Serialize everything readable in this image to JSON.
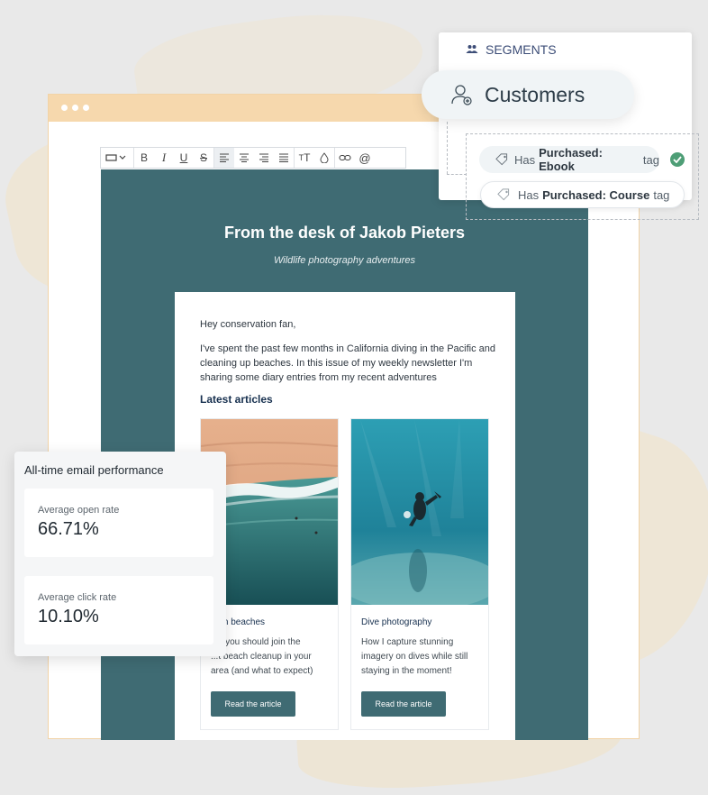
{
  "toolbar": {
    "tools": [
      "block-style-icon",
      "bold-icon",
      "italic-icon",
      "underline-icon",
      "strikethrough-icon",
      "align-left-icon",
      "align-center-icon",
      "align-right-icon",
      "align-justify-icon",
      "text-size-icon",
      "color-drop-icon",
      "link-icon",
      "mention-icon"
    ],
    "active_tool": "align-left-icon"
  },
  "email": {
    "title": "From the desk of Jakob Pieters",
    "subtitle": "Wildlife photography adventures",
    "greeting": "Hey conservation fan,",
    "intro_lines": [
      "I've spent the past few months in California diving in the Pacific and",
      "cleaning up beaches. In this issue of my weekly newsletter I'm",
      "sharing some diary entries from my recent adventures"
    ],
    "articles_heading": "Latest articles",
    "articles": [
      {
        "title": "...an beaches",
        "description": [
          "...y you should join the",
          "...t beach cleanup in your",
          "area (and what to expect)"
        ],
        "button": "Read the article"
      },
      {
        "title": "Dive photography",
        "description": [
          "How I capture stunning",
          "imagery on dives while still",
          "staying in the moment!"
        ],
        "button": "Read the article"
      }
    ]
  },
  "segments": {
    "header": "SEGMENTS",
    "selected_segment": "Customers",
    "tags": [
      {
        "prefix": "Has",
        "bold": "Purchased: Ebook",
        "suffix": "tag",
        "checked": true
      },
      {
        "prefix": "Has",
        "bold": "Purchased: Course",
        "suffix": "tag",
        "checked": false
      }
    ]
  },
  "performance": {
    "title": "All-time email performance",
    "metrics": [
      {
        "label": "Average open rate",
        "value": "66.71%"
      },
      {
        "label": "Average click rate",
        "value": "10.10%"
      }
    ]
  },
  "colors": {
    "email_background": "#3f6b73",
    "titlebar": "#f6d8ad",
    "segments_text": "#3c4d77",
    "check_green": "#4e9e76",
    "button": "#3f6b73"
  }
}
